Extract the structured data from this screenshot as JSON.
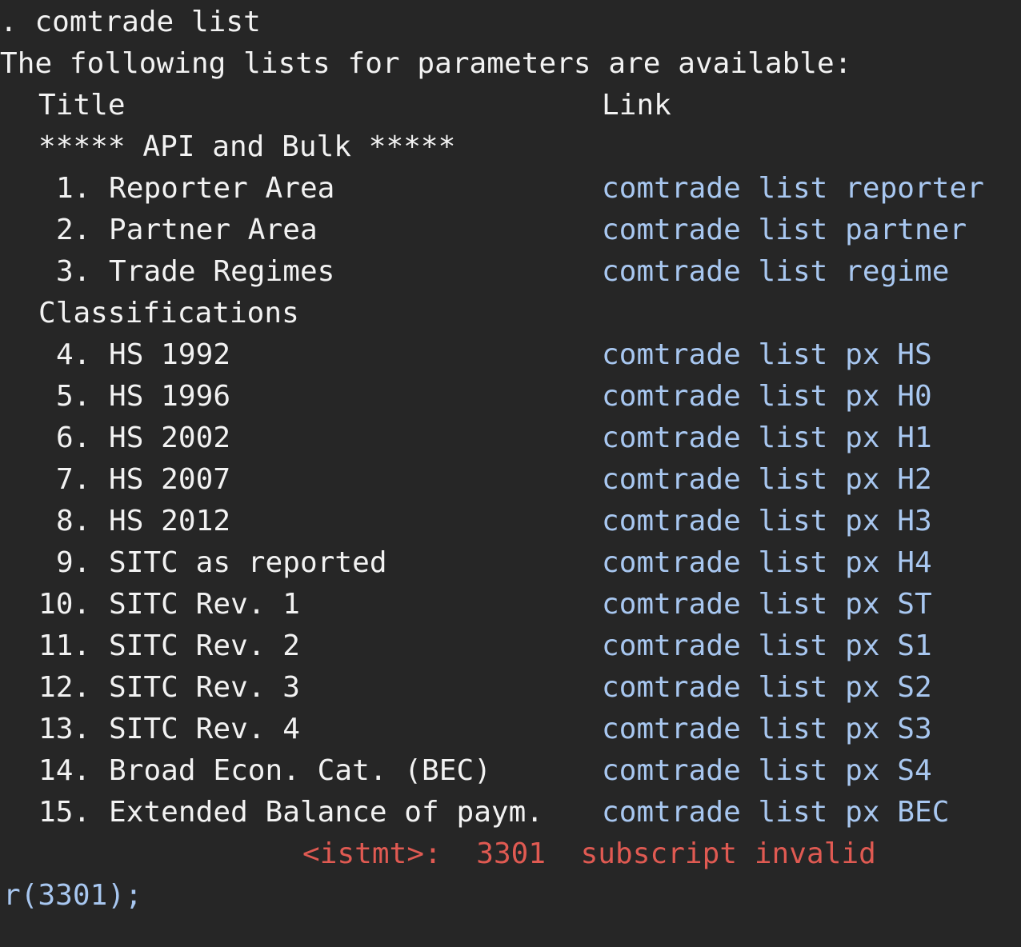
{
  "colors": {
    "background": "#262626",
    "text": "#f2f2f2",
    "link": "#a8c7f0",
    "error": "#e05a52"
  },
  "command": ". comtrade list",
  "intro": "The following lists for parameters are available:",
  "headers": {
    "title": "Title",
    "link": "Link"
  },
  "sections": {
    "api_bulk": "***** API and Bulk *****",
    "classifications": "Classifications"
  },
  "rows": [
    {
      "num": "1.",
      "title": "Reporter Area",
      "link": "comtrade list reporter"
    },
    {
      "num": "2.",
      "title": "Partner Area",
      "link": "comtrade list partner"
    },
    {
      "num": "3.",
      "title": "Trade Regimes",
      "link": "comtrade list regime"
    },
    {
      "num": "4.",
      "title": "HS 1992",
      "link": "comtrade list px HS"
    },
    {
      "num": "5.",
      "title": "HS 1996",
      "link": "comtrade list px H0"
    },
    {
      "num": "6.",
      "title": "HS 2002",
      "link": "comtrade list px H1"
    },
    {
      "num": "7.",
      "title": "HS 2007",
      "link": "comtrade list px H2"
    },
    {
      "num": "8.",
      "title": "HS 2012",
      "link": "comtrade list px H3"
    },
    {
      "num": "9.",
      "title": "SITC as reported",
      "link": "comtrade list px H4"
    },
    {
      "num": "10.",
      "title": "SITC Rev. 1",
      "link": "comtrade list px ST"
    },
    {
      "num": "11.",
      "title": "SITC Rev. 2",
      "link": "comtrade list px S1"
    },
    {
      "num": "12.",
      "title": "SITC Rev. 3",
      "link": "comtrade list px S2"
    },
    {
      "num": "13.",
      "title": "SITC Rev. 4",
      "link": "comtrade list px S3"
    },
    {
      "num": "14.",
      "title": "Broad Econ. Cat. (BEC)",
      "link": "comtrade list px S4"
    },
    {
      "num": "15.",
      "title": "Extended Balance of paym.",
      "link": "comtrade list px BEC"
    }
  ],
  "error_message": "<istmt>:  3301  subscript invalid",
  "return_code": "r(3301);"
}
